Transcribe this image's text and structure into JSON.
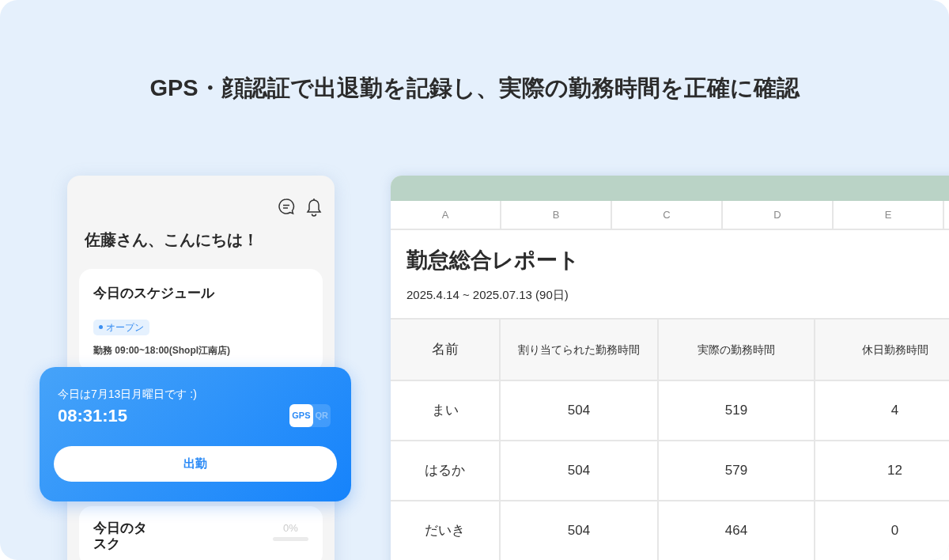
{
  "headline": "GPS・顔認証で出退勤を記録し、実際の勤務時間を正確に確認",
  "phone": {
    "greeting": "佐藤さん、こんにちは！",
    "schedule": {
      "title": "今日のスケジュール",
      "status": "オープン",
      "shift": "勤務 09:00~18:00(Shopl江南店)"
    },
    "tasks": {
      "title": "今日のタスク",
      "percent": "0%",
      "level": 0
    }
  },
  "clock_card": {
    "date": "今日は7月13日月曜日です :)",
    "time": "08:31:15",
    "modes": [
      {
        "label": "GPS",
        "selected": true
      },
      {
        "label": "QR",
        "selected": false
      }
    ],
    "button": "出勤"
  },
  "sheet": {
    "column_letters": [
      "A",
      "B",
      "C",
      "D",
      "E"
    ],
    "title": "勤怠総合レポート",
    "period": "2025.4.14 ~ 2025.07.13 (90日)",
    "table": {
      "columns": [
        "名前",
        "割り当てられた勤務時間",
        "実際の勤務時間",
        "休日勤務時間"
      ],
      "rows": [
        [
          "まい",
          "504",
          "519",
          "4"
        ],
        [
          "はるか",
          "504",
          "579",
          "12"
        ],
        [
          "だいき",
          "504",
          "464",
          "0"
        ]
      ]
    }
  }
}
